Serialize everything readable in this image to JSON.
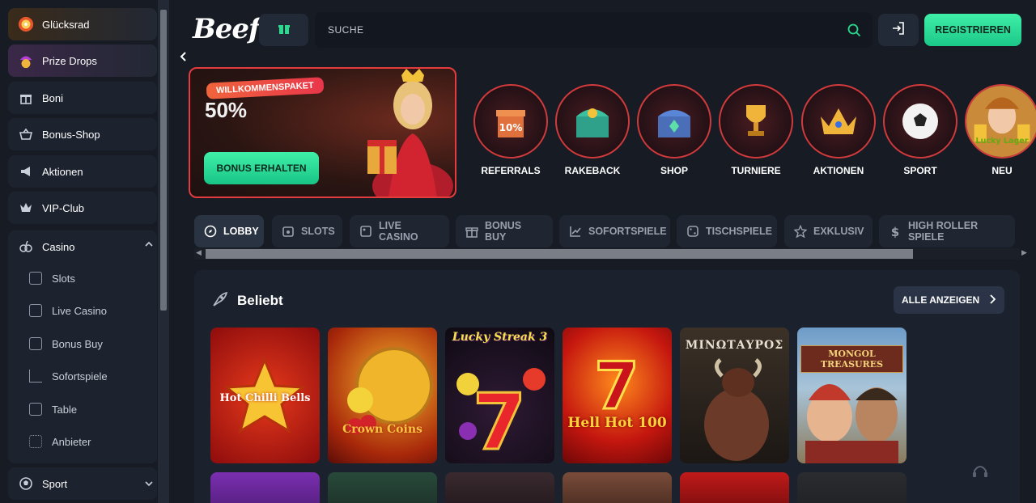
{
  "sidebar": {
    "items": [
      {
        "label": "Glücksrad",
        "icon": "wheel-icon"
      },
      {
        "label": "Prize Drops",
        "icon": "prize-drops-icon"
      },
      {
        "label": "Boni",
        "icon": "gift-icon"
      },
      {
        "label": "Bonus-Shop",
        "icon": "basket-icon"
      },
      {
        "label": "Aktionen",
        "icon": "megaphone-icon"
      },
      {
        "label": "VIP-Club",
        "icon": "crown-icon"
      }
    ],
    "casino": {
      "label": "Casino",
      "sub": [
        "Slots",
        "Live Casino",
        "Bonus Buy",
        "Sofortspiele",
        "Table",
        "Anbieter"
      ]
    },
    "sport": {
      "label": "Sport"
    }
  },
  "header": {
    "logo": "Beef",
    "search_placeholder": "SUCHE",
    "register": "REGISTRIEREN"
  },
  "promo": {
    "tag": "WILLKOMMENSPAKET",
    "percent": "50%",
    "button": "BONUS ERHALTEN"
  },
  "categories": [
    "REFERRALS",
    "RAKEBACK",
    "SHOP",
    "TURNIERE",
    "AKTIONEN",
    "SPORT",
    "NEU"
  ],
  "tabs": [
    "LOBBY",
    "SLOTS",
    "LIVE CASINO",
    "BONUS BUY",
    "SOFORTSPIELE",
    "TISCHSPIELE",
    "EXKLUSIV",
    "HIGH ROLLER SPIELE"
  ],
  "section": {
    "title": "Beliebt",
    "show_all": "ALLE ANZEIGEN"
  },
  "games": [
    {
      "title": "Hot Chilli Bells"
    },
    {
      "title": "Crown Coins"
    },
    {
      "title": "Lucky Streak 3"
    },
    {
      "title": "Hell Hot 100"
    },
    {
      "title": "ΜΙΝΩΤΑΥΡΟΣ"
    },
    {
      "title": "MONGOL TREASURES"
    }
  ],
  "colors": {
    "accent": "#1fd08f",
    "danger": "#e33b3e",
    "bg": "#161b24"
  }
}
